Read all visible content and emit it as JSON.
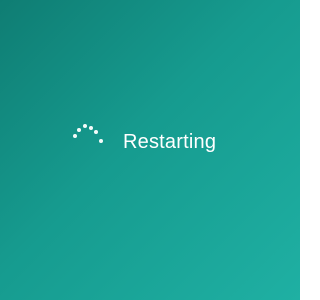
{
  "status": {
    "label": "Restarting",
    "spinner_icon": "loading-dots-icon"
  },
  "colors": {
    "background_start": "#0f7d73",
    "background_end": "#1fb0a3",
    "text": "#ffffff"
  }
}
